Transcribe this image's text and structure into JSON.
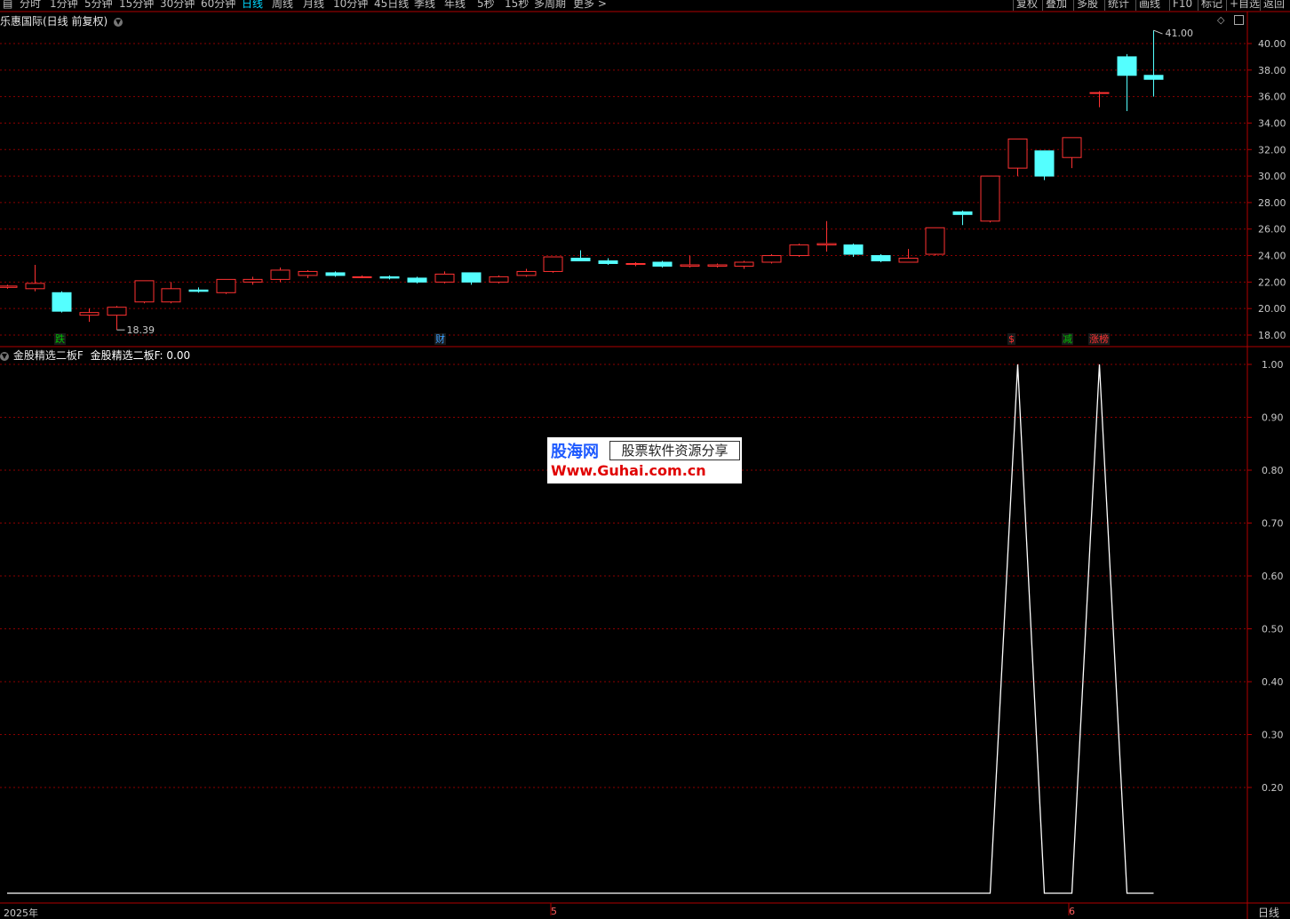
{
  "toolbar": {
    "periods": [
      "分时",
      "1分钟",
      "5分钟",
      "15分钟",
      "30分钟",
      "60分钟",
      "日线",
      "周线",
      "月线",
      "10分钟",
      "45日线",
      "季线",
      "年线",
      "5秒",
      "15秒",
      "多周期",
      "更多 >"
    ],
    "active_period": "日线",
    "right_buttons": [
      "复权",
      "叠加",
      "多股",
      "统计",
      "画线",
      "F10",
      "标记",
      "+自选",
      "返回"
    ]
  },
  "main_panel": {
    "title": "乐惠国际(日线 前复权)",
    "price_ticks": [
      "40.00",
      "38.00",
      "36.00",
      "34.00",
      "32.00",
      "30.00",
      "28.00",
      "26.00",
      "24.00",
      "22.00",
      "20.00",
      "18.00"
    ],
    "high_label": "41.00",
    "low_label": "18.39",
    "events": [
      {
        "text": "跌",
        "color": "#00c000"
      },
      {
        "text": "财",
        "color": "#3aa0ff"
      },
      {
        "text": "$",
        "color": "#ff3030"
      },
      {
        "text": "减",
        "color": "#00c000"
      },
      {
        "text": "涨榜",
        "color": "#ff3030"
      }
    ]
  },
  "indicator_panel": {
    "title": "金股精选二板F",
    "value_label": "金股精选二板F: 0.00",
    "value_ticks": [
      "1.00",
      "0.90",
      "0.80",
      "0.70",
      "0.60",
      "0.50",
      "0.40",
      "0.30",
      "0.20"
    ],
    "values": [
      0,
      0,
      0,
      0,
      0,
      0,
      0,
      0,
      0,
      0,
      0,
      0,
      0,
      0,
      0,
      0,
      0,
      0,
      0,
      0,
      0,
      0,
      0,
      0,
      0,
      0,
      0,
      0,
      0,
      0,
      0,
      0,
      0,
      0,
      0,
      0,
      0,
      1,
      0,
      0,
      1,
      0,
      0
    ]
  },
  "x_axis": {
    "dates": [
      "2025年",
      "5",
      "6"
    ],
    "period_label": "日线"
  },
  "watermark": {
    "brand": "股海网",
    "tagline": "股票软件资源分享",
    "url": "Www.Guhai.com.cn"
  },
  "colors": {
    "up": "#ff3232",
    "down": "#54ffff",
    "grid": "#8b0000",
    "axis": "#b00000",
    "indicator_line": "#ffffff"
  },
  "chart_data": {
    "type": "candlestick",
    "y_range": [
      17.5,
      41.5
    ],
    "candles": [
      {
        "o": 21.6,
        "c": 21.7,
        "h": 21.8,
        "l": 21.5
      },
      {
        "o": 21.5,
        "c": 21.9,
        "h": 23.3,
        "l": 21.3
      },
      {
        "o": 21.2,
        "c": 19.8,
        "h": 21.3,
        "l": 19.7
      },
      {
        "o": 19.5,
        "c": 19.7,
        "h": 20.0,
        "l": 19.0
      },
      {
        "o": 19.5,
        "c": 20.1,
        "h": 20.2,
        "l": 18.39
      },
      {
        "o": 20.5,
        "c": 22.1,
        "h": 22.1,
        "l": 20.4
      },
      {
        "o": 20.5,
        "c": 21.5,
        "h": 22.0,
        "l": 20.4
      },
      {
        "o": 21.4,
        "c": 21.3,
        "h": 21.6,
        "l": 21.2
      },
      {
        "o": 21.2,
        "c": 22.2,
        "h": 22.2,
        "l": 21.1
      },
      {
        "o": 22.0,
        "c": 22.2,
        "h": 22.4,
        "l": 21.8
      },
      {
        "o": 22.2,
        "c": 22.9,
        "h": 23.1,
        "l": 22.0
      },
      {
        "o": 22.5,
        "c": 22.8,
        "h": 22.9,
        "l": 22.3
      },
      {
        "o": 22.7,
        "c": 22.5,
        "h": 22.8,
        "l": 22.4
      },
      {
        "o": 22.4,
        "c": 22.4,
        "h": 22.5,
        "l": 22.3
      },
      {
        "o": 22.4,
        "c": 22.3,
        "h": 22.5,
        "l": 22.2
      },
      {
        "o": 22.3,
        "c": 22.0,
        "h": 22.4,
        "l": 21.9
      },
      {
        "o": 22.0,
        "c": 22.6,
        "h": 22.8,
        "l": 21.9
      },
      {
        "o": 22.7,
        "c": 22.0,
        "h": 22.7,
        "l": 21.8
      },
      {
        "o": 22.0,
        "c": 22.4,
        "h": 22.5,
        "l": 21.9
      },
      {
        "o": 22.5,
        "c": 22.8,
        "h": 23.0,
        "l": 22.4
      },
      {
        "o": 22.8,
        "c": 23.9,
        "h": 23.9,
        "l": 22.7
      },
      {
        "o": 23.8,
        "c": 23.6,
        "h": 24.4,
        "l": 23.6
      },
      {
        "o": 23.6,
        "c": 23.4,
        "h": 23.8,
        "l": 23.3
      },
      {
        "o": 23.4,
        "c": 23.4,
        "h": 23.5,
        "l": 23.2
      },
      {
        "o": 23.5,
        "c": 23.2,
        "h": 23.6,
        "l": 23.1
      },
      {
        "o": 23.2,
        "c": 23.3,
        "h": 24.0,
        "l": 23.1
      },
      {
        "o": 23.2,
        "c": 23.3,
        "h": 23.4,
        "l": 23.1
      },
      {
        "o": 23.2,
        "c": 23.5,
        "h": 23.6,
        "l": 23.0
      },
      {
        "o": 23.5,
        "c": 24.0,
        "h": 24.1,
        "l": 23.4
      },
      {
        "o": 24.0,
        "c": 24.8,
        "h": 24.9,
        "l": 23.9
      },
      {
        "o": 24.8,
        "c": 24.9,
        "h": 26.6,
        "l": 24.3
      },
      {
        "o": 24.8,
        "c": 24.1,
        "h": 24.9,
        "l": 23.9
      },
      {
        "o": 24.0,
        "c": 23.6,
        "h": 24.1,
        "l": 23.5
      },
      {
        "o": 23.5,
        "c": 23.8,
        "h": 24.5,
        "l": 23.5
      },
      {
        "o": 24.1,
        "c": 26.1,
        "h": 26.1,
        "l": 24.0
      },
      {
        "o": 27.3,
        "c": 27.1,
        "h": 27.4,
        "l": 26.3
      },
      {
        "o": 26.6,
        "c": 30.0,
        "h": 30.0,
        "l": 26.5
      },
      {
        "o": 30.6,
        "c": 32.8,
        "h": 32.8,
        "l": 30.0
      },
      {
        "o": 31.9,
        "c": 30.0,
        "h": 31.9,
        "l": 29.7
      },
      {
        "o": 31.4,
        "c": 32.9,
        "h": 32.9,
        "l": 30.6
      },
      {
        "o": 36.3,
        "c": 36.3,
        "h": 36.4,
        "l": 35.2
      },
      {
        "o": 39.0,
        "c": 37.6,
        "h": 39.2,
        "l": 34.9
      },
      {
        "o": 37.6,
        "c": 37.3,
        "h": 41.0,
        "l": 36.0
      }
    ]
  }
}
